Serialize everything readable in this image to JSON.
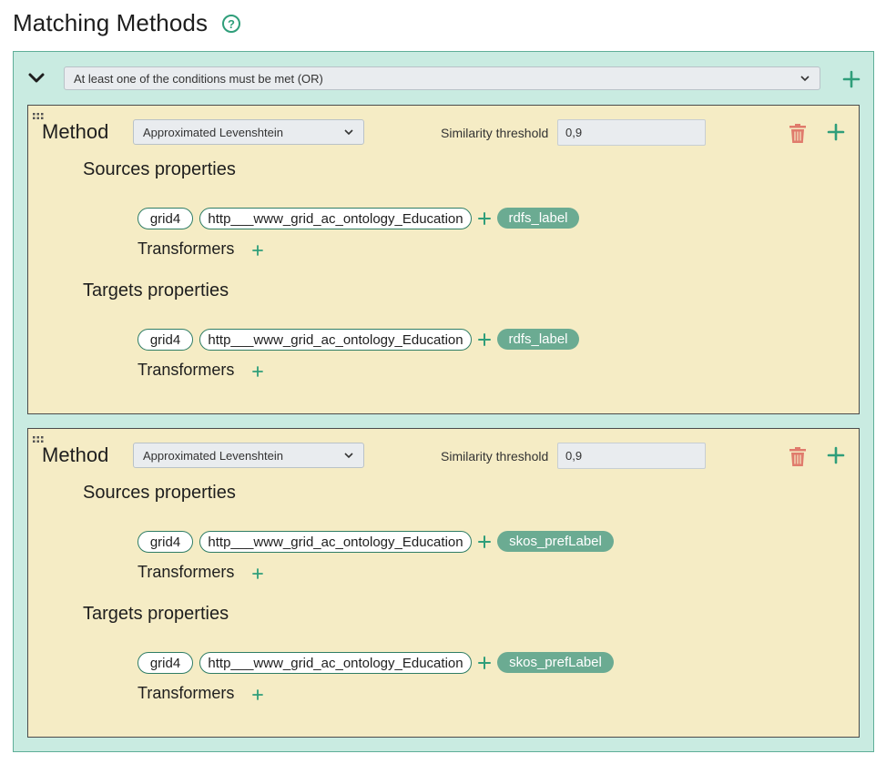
{
  "header": {
    "title": "Matching Methods",
    "help_icon": "question-circle-icon"
  },
  "condition": {
    "selected": "At least one of the conditions must be met (OR)"
  },
  "colors": {
    "accent": "#2f9e7a",
    "outer_bg": "#c9ebe1",
    "method_bg": "#f5ecc5",
    "pill_filled": "#6bab92",
    "trash": "#e07b6c"
  },
  "methods": [
    {
      "label": "Method",
      "algorithm": "Approximated Levenshtein",
      "threshold_label": "Similarity threshold",
      "threshold_value": "0,9",
      "sources": {
        "title": "Sources properties",
        "dataset": "grid4",
        "entity_type": "http___www_grid_ac_ontology_Education",
        "property": "rdfs_label",
        "transformers_label": "Transformers"
      },
      "targets": {
        "title": "Targets properties",
        "dataset": "grid4",
        "entity_type": "http___www_grid_ac_ontology_Education",
        "property": "rdfs_label",
        "transformers_label": "Transformers"
      }
    },
    {
      "label": "Method",
      "algorithm": "Approximated Levenshtein",
      "threshold_label": "Similarity threshold",
      "threshold_value": "0,9",
      "sources": {
        "title": "Sources properties",
        "dataset": "grid4",
        "entity_type": "http___www_grid_ac_ontology_Education",
        "property": "skos_prefLabel",
        "transformers_label": "Transformers"
      },
      "targets": {
        "title": "Targets properties",
        "dataset": "grid4",
        "entity_type": "http___www_grid_ac_ontology_Education",
        "property": "skos_prefLabel",
        "transformers_label": "Transformers"
      }
    }
  ]
}
